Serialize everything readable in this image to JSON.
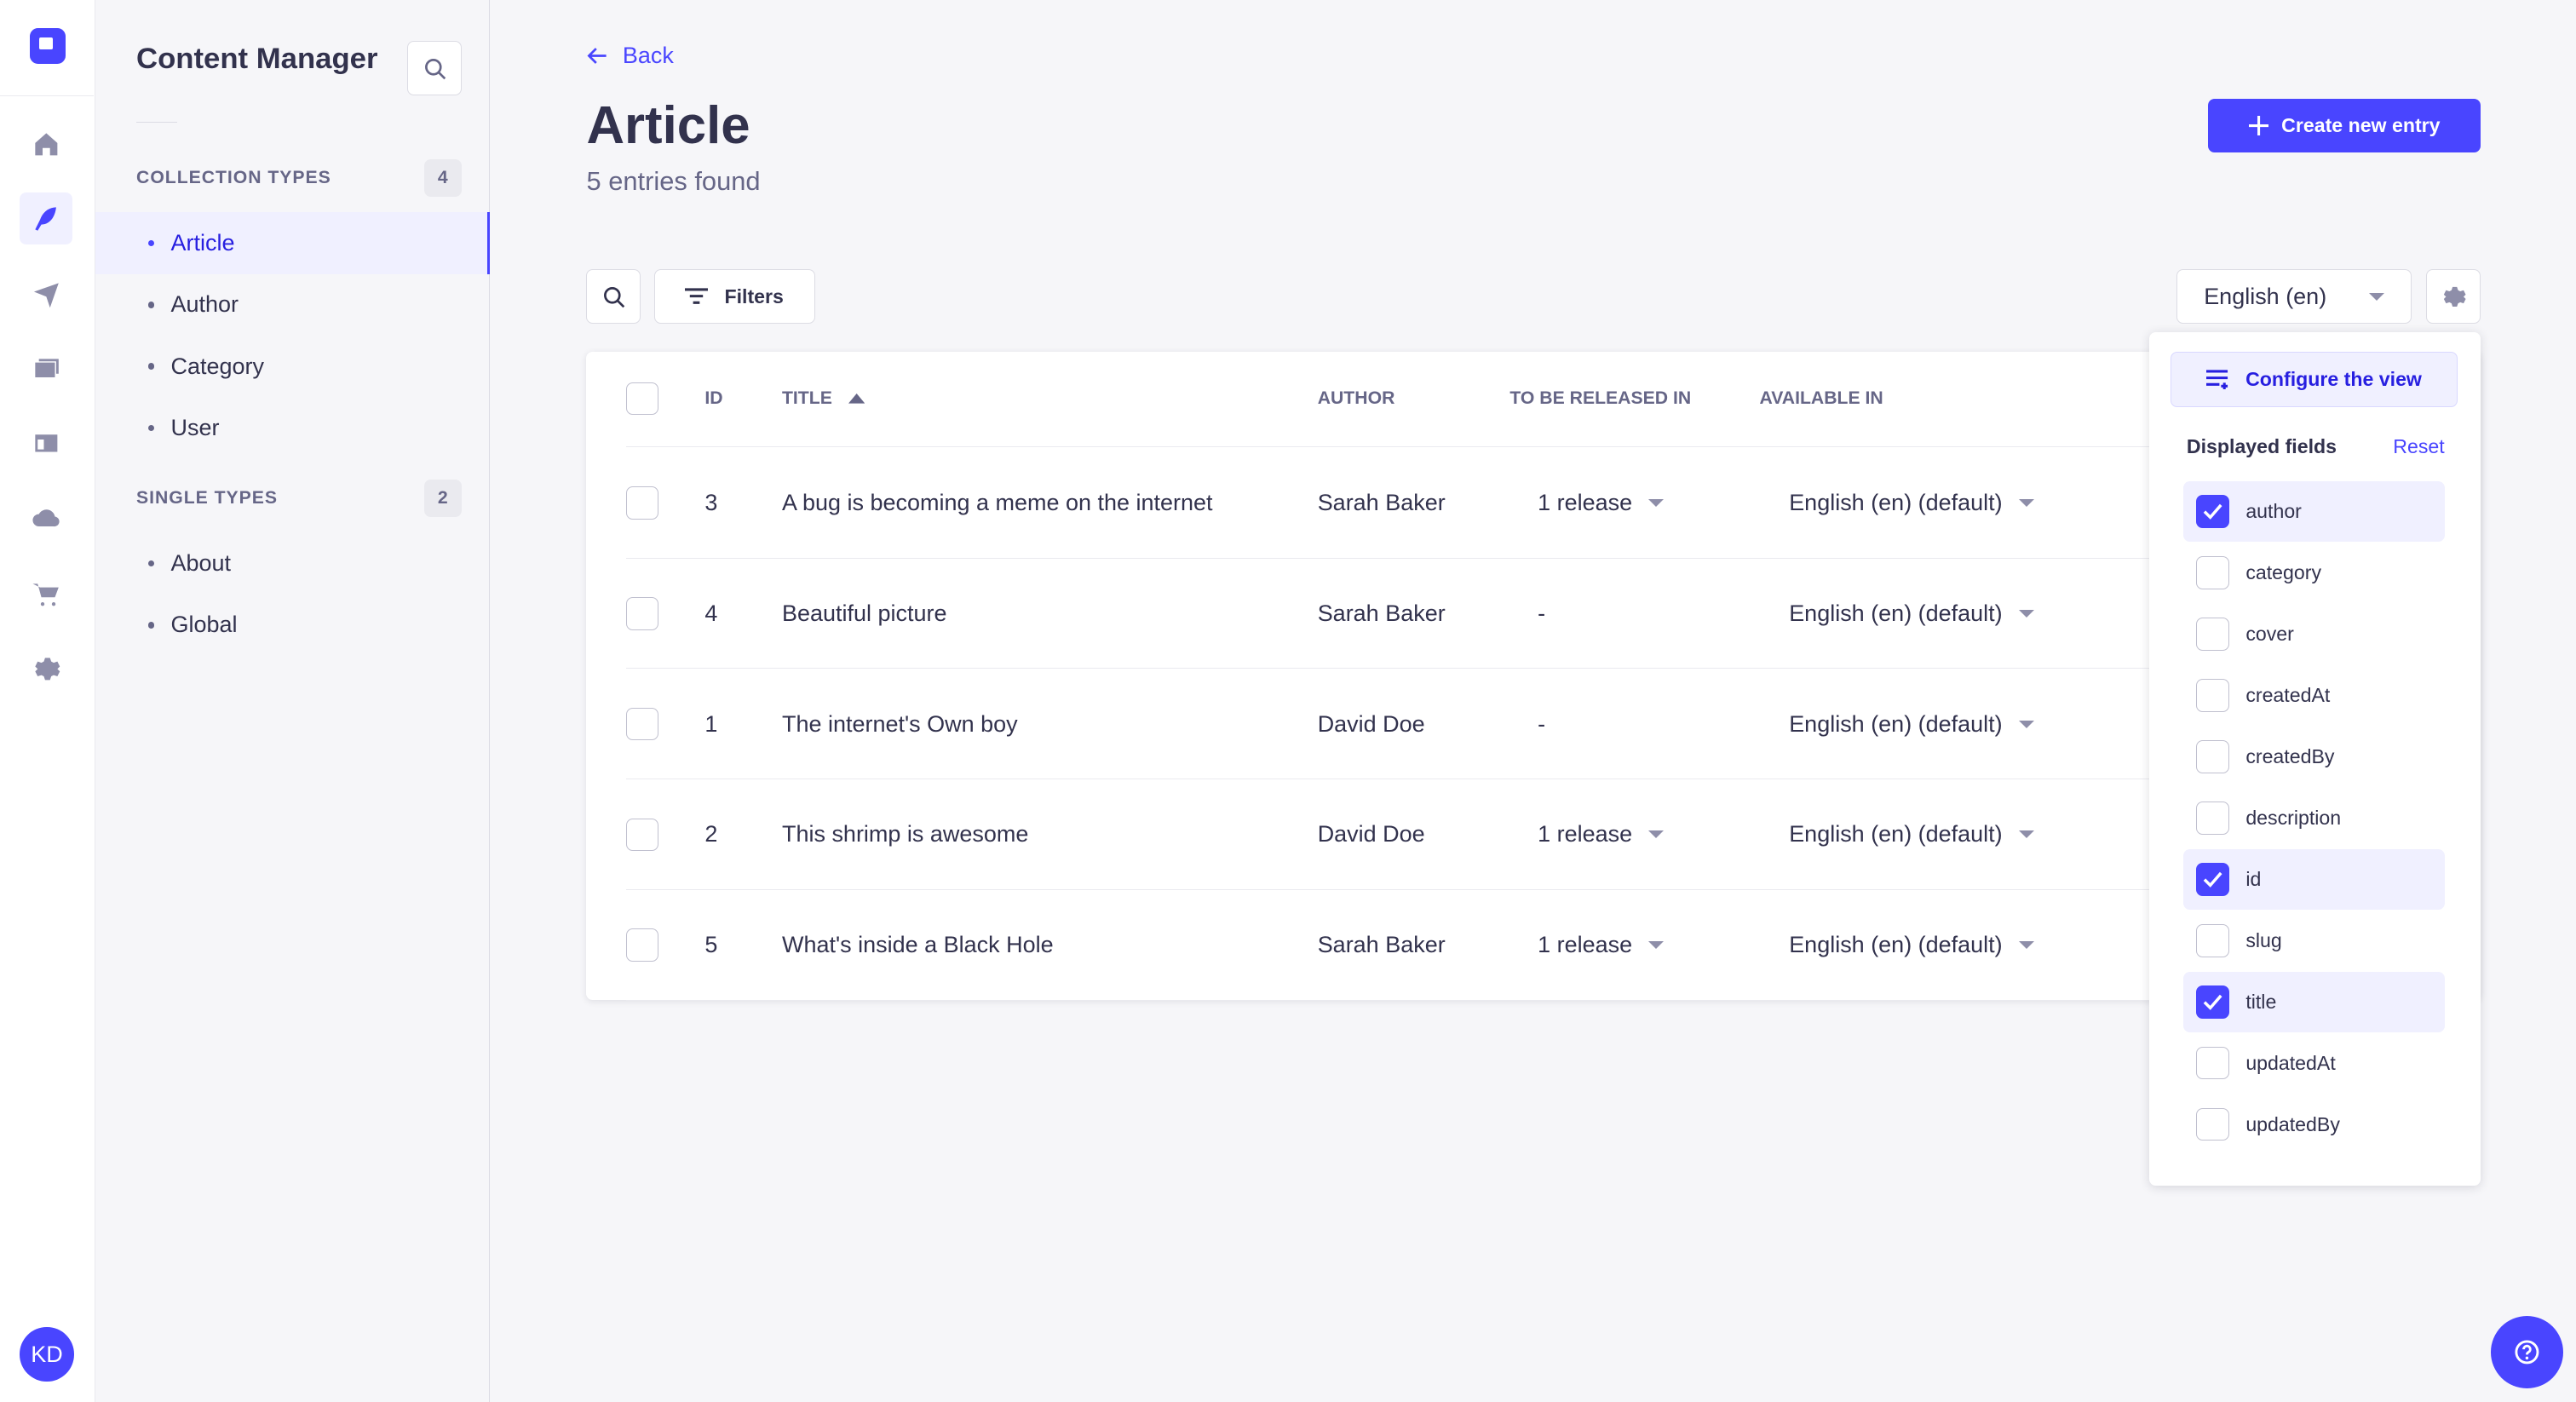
{
  "user": {
    "initials": "KD"
  },
  "mainnav": [
    "home-icon",
    "content-manager-icon",
    "releases-icon",
    "media-library-icon",
    "content-type-builder-icon",
    "cloud-icon",
    "marketplace-icon",
    "settings-icon"
  ],
  "subnav": {
    "title": "Content Manager",
    "collection_label": "COLLECTION TYPES",
    "collection_count": "4",
    "collection_items": [
      "Article",
      "Author",
      "Category",
      "User"
    ],
    "single_label": "SINGLE TYPES",
    "single_count": "2",
    "single_items": [
      "About",
      "Global"
    ]
  },
  "header": {
    "back": "Back",
    "title": "Article",
    "subtitle": "5 entries found",
    "create": "Create new entry"
  },
  "toolbar": {
    "filters": "Filters",
    "locale": "English (en)"
  },
  "table": {
    "columns": [
      "ID",
      "TITLE",
      "AUTHOR",
      "TO BE RELEASED IN",
      "AVAILABLE IN"
    ],
    "rows": [
      {
        "id": "3",
        "title": "A bug is becoming a meme on the internet",
        "author": "Sarah Baker",
        "release": "1 release",
        "available": "English (en) (default)"
      },
      {
        "id": "4",
        "title": "Beautiful picture",
        "author": "Sarah Baker",
        "release": "-",
        "available": "English (en) (default)"
      },
      {
        "id": "1",
        "title": "The internet's Own boy",
        "author": "David Doe",
        "release": "-",
        "available": "English (en) (default)"
      },
      {
        "id": "2",
        "title": "This shrimp is awesome",
        "author": "David Doe",
        "release": "1 release",
        "available": "English (en) (default)"
      },
      {
        "id": "5",
        "title": "What's inside a Black Hole",
        "author": "Sarah Baker",
        "release": "1 release",
        "available": "English (en) (default)"
      }
    ]
  },
  "popover": {
    "configure": "Configure the view",
    "displayed": "Displayed fields",
    "reset": "Reset",
    "fields": [
      {
        "name": "author",
        "checked": true
      },
      {
        "name": "category",
        "checked": false
      },
      {
        "name": "cover",
        "checked": false
      },
      {
        "name": "createdAt",
        "checked": false
      },
      {
        "name": "createdBy",
        "checked": false
      },
      {
        "name": "description",
        "checked": false
      },
      {
        "name": "id",
        "checked": true
      },
      {
        "name": "slug",
        "checked": false
      },
      {
        "name": "title",
        "checked": true
      },
      {
        "name": "updatedAt",
        "checked": false
      },
      {
        "name": "updatedBy",
        "checked": false
      }
    ]
  },
  "colors": {
    "primary": "#4945ff",
    "primary_light": "#f0f0ff",
    "bg": "#f6f6f9"
  }
}
